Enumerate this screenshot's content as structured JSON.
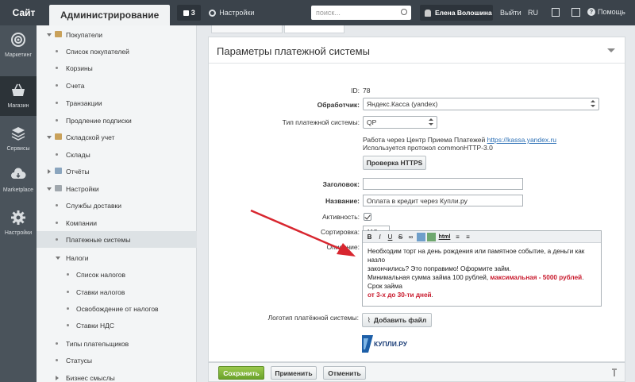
{
  "topbar": {
    "site_tab": "Сайт",
    "admin_tab": "Администрирование",
    "notifications_count": "3",
    "settings_label": "Настройки",
    "search_placeholder": "поиск...",
    "user_name": "Елена Волошина",
    "exit_label": "Выйти",
    "language": "RU",
    "help_label": "Помощь"
  },
  "iconbar": {
    "items": [
      {
        "label": "Маркетинг"
      },
      {
        "label": "Магазин"
      },
      {
        "label": "Сервисы"
      },
      {
        "label": "Marketplace"
      },
      {
        "label": "Настройки"
      }
    ]
  },
  "tree": {
    "items": [
      {
        "label": "Покупатели"
      },
      {
        "label": "Список покупателей"
      },
      {
        "label": "Корзины"
      },
      {
        "label": "Счета"
      },
      {
        "label": "Транзакции"
      },
      {
        "label": "Продление подписки"
      },
      {
        "label": "Складской учет"
      },
      {
        "label": "Склады"
      },
      {
        "label": "Отчёты"
      },
      {
        "label": "Настройки"
      },
      {
        "label": "Службы доставки"
      },
      {
        "label": "Компании"
      },
      {
        "label": "Платежные системы"
      },
      {
        "label": "Налоги"
      },
      {
        "label": "Список налогов"
      },
      {
        "label": "Ставки налогов"
      },
      {
        "label": "Освобождение от налогов"
      },
      {
        "label": "Ставки НДС"
      },
      {
        "label": "Типы плательщиков"
      },
      {
        "label": "Статусы"
      },
      {
        "label": "Бизнес смыслы"
      }
    ]
  },
  "panel": {
    "title": "Параметры платежной системы",
    "id_label": "ID:",
    "id_value": "78",
    "handler_label": "Обработчик:",
    "handler_value": "Яндекс.Касса (yandex)",
    "type_label": "Тип платежной системы:",
    "type_value": "QP",
    "info_line1": "Работа через Центр Приема Платежей",
    "info_link": "https://kassa.yandex.ru",
    "info_line2": "Используется протокол commonHTTP-3.0",
    "check_https": "Проверка HTTPS",
    "header_label": "Заголовок:",
    "header_value": "",
    "name_label": "Название:",
    "name_value": "Оплата в кредит через Купли.ру",
    "active_label": "Активность:",
    "sort_label": "Сортировка:",
    "sort_value": "115",
    "desc_label": "Описание:",
    "desc_line1": "Необходим торт на день рождения или памятное событие, а деньги как назло",
    "desc_line2": "закончились? Это поправимо! Оформите займ.",
    "desc_line3a": "Минимальная сумма займа 100 рублей, ",
    "desc_line3b": "максимальная - 5000 рублей",
    "desc_line3c": ". Срок займа",
    "desc_line4": "от 3-х до 30-ти дней",
    "desc_line4end": ".",
    "logo_label": "Логотип платёжной системы:",
    "add_file": "Добавить файл",
    "logo_text": "КУПЛИ.РУ"
  },
  "footer": {
    "save": "Сохранить",
    "apply": "Применить",
    "cancel": "Отменить"
  },
  "colors": {
    "accent_red": "#c8192c",
    "save_green": "#6aa22a",
    "topbar": "#3b434b"
  }
}
